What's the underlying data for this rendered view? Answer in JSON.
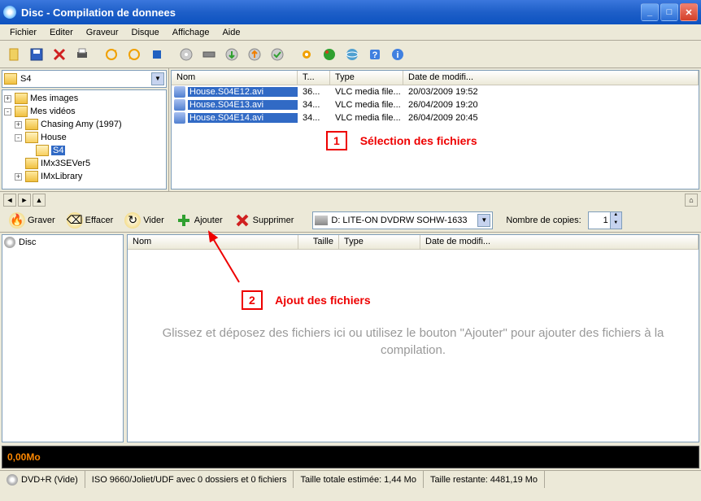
{
  "window": {
    "title": "Disc - Compilation de donnees"
  },
  "menu": {
    "items": [
      "Fichier",
      "Editer",
      "Graveur",
      "Disque",
      "Affichage",
      "Aide"
    ]
  },
  "browser": {
    "current_folder": "S4",
    "tree": [
      {
        "indent": 0,
        "pm": "+",
        "icon": "fld",
        "label": "Mes images"
      },
      {
        "indent": 0,
        "pm": "-",
        "icon": "fld",
        "label": "Mes vidéos"
      },
      {
        "indent": 1,
        "pm": "+",
        "icon": "fld",
        "label": "Chasing Amy (1997)"
      },
      {
        "indent": 1,
        "pm": "-",
        "icon": "fldo",
        "label": "House"
      },
      {
        "indent": 2,
        "pm": "",
        "icon": "fldo",
        "label": "S4",
        "selected": true
      },
      {
        "indent": 1,
        "pm": "",
        "icon": "fld",
        "label": "IMx3SEVer5"
      },
      {
        "indent": 1,
        "pm": "+",
        "icon": "fld",
        "label": "IMxLibrary"
      }
    ],
    "columns": {
      "name": "Nom",
      "size": "T...",
      "type": "Type",
      "date": "Date de modifi..."
    },
    "files": [
      {
        "name": "House.S04E12.avi",
        "size": "36...",
        "type": "VLC media file...",
        "date": "20/03/2009 19:52"
      },
      {
        "name": "House.S04E13.avi",
        "size": "34...",
        "type": "VLC media file...",
        "date": "26/04/2009 19:20"
      },
      {
        "name": "House.S04E14.avi",
        "size": "34...",
        "type": "VLC media file...",
        "date": "26/04/2009 20:45"
      }
    ]
  },
  "callouts": {
    "c1_num": "1",
    "c1_text": "Sélection des fichiers",
    "c2_num": "2",
    "c2_text": "Ajout des fichiers"
  },
  "actions": {
    "graver": "Graver",
    "effacer": "Effacer",
    "vider": "Vider",
    "ajouter": "Ajouter",
    "supprimer": "Supprimer",
    "drive": "D: LITE-ON DVDRW SOHW-1633",
    "copies_label": "Nombre de copies:",
    "copies_value": "1"
  },
  "compilation": {
    "root": "Disc",
    "columns": {
      "name": "Nom",
      "size": "Taille",
      "type": "Type",
      "date": "Date de modifi..."
    },
    "drop_hint": "Glissez et déposez des fichiers ici ou utilisez le bouton \"Ajouter\" pour ajouter des fichiers à la compilation."
  },
  "progress": {
    "text": "0,00Mo"
  },
  "status": {
    "disc": "DVD+R (Vide)",
    "fs": "ISO 9660/Joliet/UDF avec 0 dossiers et 0 fichiers",
    "total": "Taille totale estimée: 1,44 Mo",
    "remain": "Taille restante: 4481,19 Mo"
  }
}
